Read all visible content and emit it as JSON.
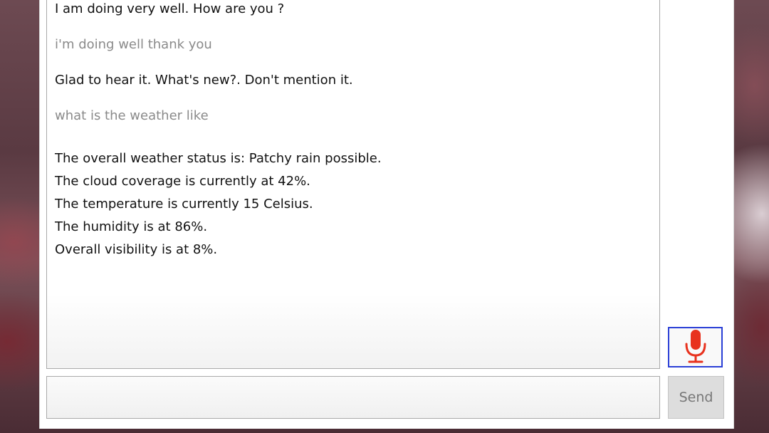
{
  "chat": {
    "messages": [
      {
        "role": "bot",
        "text": "I am doing very well. How are you  ?"
      },
      {
        "role": "user",
        "text": "i'm doing well thank you"
      },
      {
        "role": "bot",
        "text": "Glad to hear it. What's new?. Don't mention it."
      },
      {
        "role": "user",
        "text": "what is the weather like"
      }
    ],
    "weather_lines": [
      "The overall weather status is: Patchy rain possible.",
      "The cloud coverage is currently at 42%.",
      "The temperature is currently 15 Celsius.",
      "The humidity is at 86%.",
      "Overall visibility is at 8%."
    ]
  },
  "input": {
    "value": "",
    "placeholder": ""
  },
  "controls": {
    "send_label": "Send",
    "mic_icon": "microphone-icon",
    "mic_color": "#e8321e",
    "mic_border_color": "#2a3fd6"
  }
}
